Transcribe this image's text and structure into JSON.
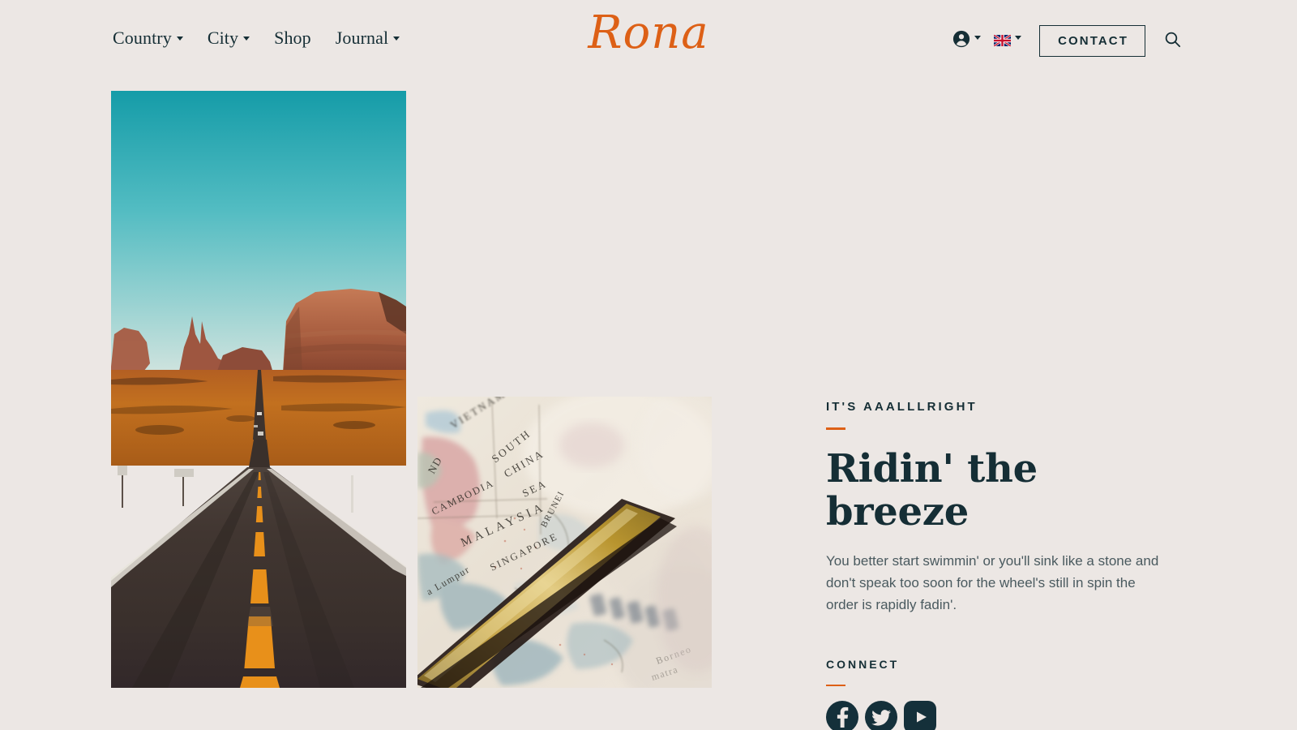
{
  "page": {
    "background_color": "#ece7e4",
    "accent_color": "#dd6016",
    "text_color": "#152e35"
  },
  "header": {
    "logo": "Rona",
    "nav": [
      {
        "label": "Country",
        "has_dropdown": true
      },
      {
        "label": "City",
        "has_dropdown": true
      },
      {
        "label": "Shop",
        "has_dropdown": false
      },
      {
        "label": "Journal",
        "has_dropdown": true
      }
    ],
    "account": {
      "icon": "account-circle-icon",
      "has_dropdown": true
    },
    "language": {
      "icon": "uk-flag-icon",
      "value": "English",
      "has_dropdown": true
    },
    "contact_label": "CONTACT",
    "search": {
      "icon": "search-icon"
    }
  },
  "hero": {
    "eyebrow": "IT'S AAALLLRIGHT",
    "headline": "Ridin' the breeze",
    "body": "You better start swimmin' or you'll sink like a stone and don't speak too soon for the wheel's still in spin the order is rapidly fadin'.",
    "connect_label": "CONNECT",
    "social": [
      {
        "name": "facebook",
        "label": "Facebook",
        "shape": "circle"
      },
      {
        "name": "twitter",
        "label": "Twitter",
        "shape": "circle"
      },
      {
        "name": "youtube",
        "label": "YouTube",
        "shape": "rounded-rect"
      }
    ]
  },
  "images": [
    {
      "name": "desert-road-image",
      "alt": "Empty desert highway with yellow center line running toward red sandstone buttes under a teal sky"
    },
    {
      "name": "globe-map-image",
      "alt": "Close-up of a vintage globe showing Malaysia, Singapore and the South China Sea with a gold meridian ring"
    }
  ]
}
